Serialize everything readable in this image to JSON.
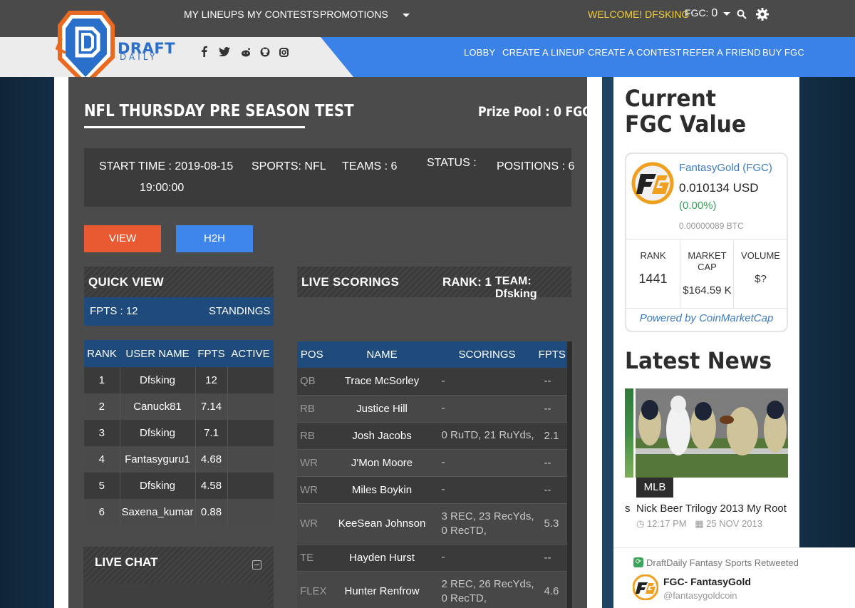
{
  "topbar": {
    "nav": [
      "MY LINEUPS",
      "MY CONTESTS",
      "PROMOTIONS"
    ],
    "welcome": "WELCOME! DFSKING",
    "fgc_label": "FGC:",
    "fgc_value": "0"
  },
  "brand": {
    "line1": "DRAFT",
    "line2": "DAILY"
  },
  "social": [
    "facebook",
    "twitter",
    "reddit",
    "github",
    "instagram"
  ],
  "mainnav": [
    "LOBBY",
    "CREATE A LINEUP",
    "CREATE A CONTEST",
    "REFER A FRIEND",
    "BUY FGC"
  ],
  "contest": {
    "title": "NFL THURSDAY PRE SEASON TEST",
    "prize_pool": "Prize Pool : 0 FGC",
    "start_time_line1": "START TIME : 2019-08-15",
    "start_time_line2": "19:00:00",
    "sports": "SPORTS: NFL",
    "teams": "TEAMS : 6",
    "status": "STATUS :",
    "positions": "POSITIONS : 6"
  },
  "buttons": {
    "view": "VIEW",
    "h2h": "H2H"
  },
  "quick_view": {
    "title": "QUICK VIEW",
    "fpts": "FPTS : 12",
    "standings": "STANDINGS",
    "headers": [
      "RANK",
      "USER NAME",
      "FPTS",
      "ACTIVE"
    ],
    "rows": [
      {
        "rank": "1",
        "user": "Dfsking",
        "fpts": "12",
        "active": ""
      },
      {
        "rank": "2",
        "user": "Canuck81",
        "fpts": "7.14",
        "active": ""
      },
      {
        "rank": "3",
        "user": "Dfsking",
        "fpts": "7.1",
        "active": ""
      },
      {
        "rank": "4",
        "user": "Fantasyguru1",
        "fpts": "4.68",
        "active": ""
      },
      {
        "rank": "5",
        "user": "Dfsking",
        "fpts": "4.58",
        "active": ""
      },
      {
        "rank": "6",
        "user": "Saxena_kumar",
        "fpts": "0.88",
        "active": ""
      }
    ]
  },
  "live_scorings": {
    "title": "LIVE SCORINGS",
    "rank": "RANK: 1",
    "team": "TEAM: Dfsking",
    "headers": [
      "POS",
      "NAME",
      "SCORINGS",
      "FPTS"
    ],
    "rows": [
      {
        "pos": "QB",
        "name": "Trace McSorley",
        "scorings": "-",
        "fpts": "--"
      },
      {
        "pos": "RB",
        "name": "Justice Hill",
        "scorings": "-",
        "fpts": "--"
      },
      {
        "pos": "RB",
        "name": "Josh Jacobs",
        "scorings": "0 RuTD, 21 RuYds,",
        "fpts": "2.1"
      },
      {
        "pos": "WR",
        "name": "J'Mon Moore",
        "scorings": "-",
        "fpts": "--"
      },
      {
        "pos": "WR",
        "name": "Miles Boykin",
        "scorings": "-",
        "fpts": "--"
      },
      {
        "pos": "WR",
        "name": "KeeSean Johnson",
        "scorings": "3 REC, 23 RecYds, 0 RecTD,",
        "fpts": "5.3"
      },
      {
        "pos": "TE",
        "name": "Hayden Hurst",
        "scorings": "-",
        "fpts": "--"
      },
      {
        "pos": "FLEX",
        "name": "Hunter Renfrow",
        "scorings": "2 REC, 26 RecYds, 0 RecTD,",
        "fpts": "4.6"
      }
    ]
  },
  "live_chat": {
    "title": "LIVE CHAT"
  },
  "sidebar": {
    "fgc_title": "Current FGC Value",
    "widget": {
      "name": "FantasyGold (FGC)",
      "price": "0.010134 USD",
      "change": "(0.00%)",
      "btc": "0.00000089 BTC",
      "rank_label": "RANK",
      "rank_value": "1441",
      "mcap_label": "MARKET CAP",
      "mcap_value": "$164.59 K",
      "volume_label": "VOLUME",
      "volume_value": "$?",
      "powered": "Powered by CoinMarketCap"
    },
    "news_title": "Latest News",
    "news": {
      "tag": "MLB",
      "headline": "Nick Beer Trilogy 2013 My Root",
      "prev_fragment": "s",
      "time": "12:17 PM",
      "date": "25 NOV 2013"
    },
    "twitter": {
      "retweet": "DraftDaily Fantasy Sports Retweeted",
      "name": "FGC- FantasyGold",
      "handle": "@fantasygoldcoin"
    }
  }
}
